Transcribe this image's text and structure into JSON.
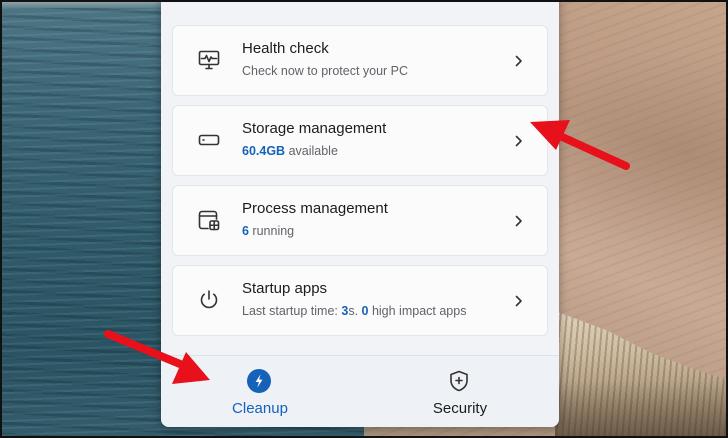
{
  "cards": [
    {
      "title": "Health check",
      "subtitle": "Check now to protect your PC",
      "icon": "monitor-pulse-icon"
    },
    {
      "title": "Storage management",
      "value": "60.4GB",
      "subtitle_suffix": " available",
      "icon": "drive-icon"
    },
    {
      "title": "Process management",
      "value": "6",
      "subtitle_suffix": " running",
      "icon": "app-window-icon"
    },
    {
      "title": "Startup apps",
      "subtitle_prefix": "Last startup time: ",
      "time_value": "3",
      "time_unit": "s. ",
      "impact_value": "0",
      "impact_suffix": " high impact apps",
      "icon": "power-icon"
    }
  ],
  "nav": {
    "cleanup_label": "Cleanup",
    "security_label": "Security"
  },
  "colors": {
    "accent": "#1562b8",
    "annotation_arrow": "#e8101a"
  }
}
